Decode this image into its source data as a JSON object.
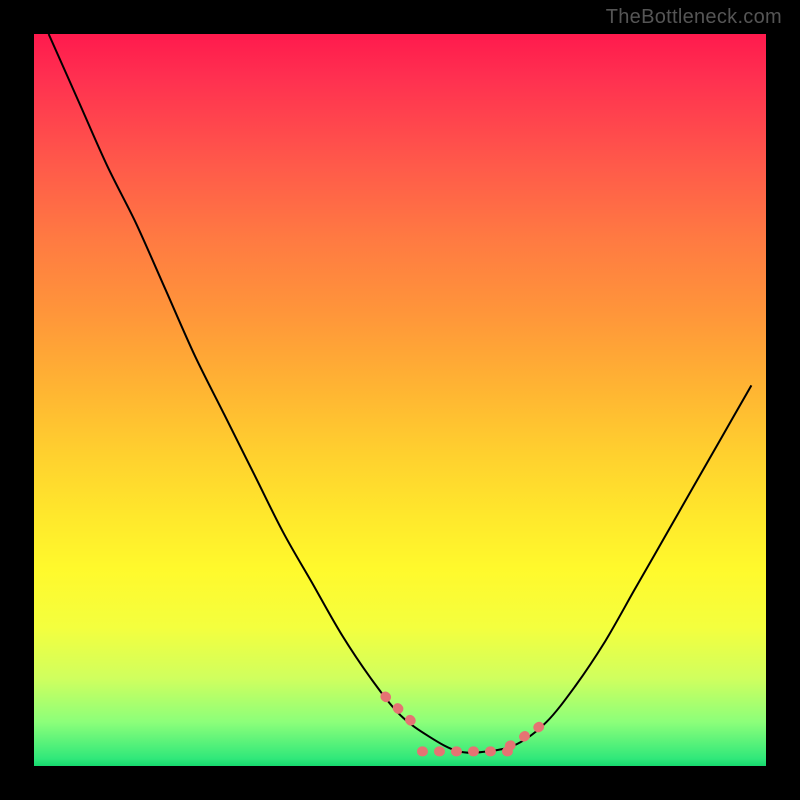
{
  "attribution": "TheBottleneck.com",
  "colors": {
    "gradient_top": "#ff1a4d",
    "gradient_mid": "#ffe82c",
    "gradient_bottom": "#16d86e",
    "curve": "#000000",
    "highlight": "#e57373",
    "border": "#000000"
  },
  "chart_data": {
    "type": "line",
    "title": "",
    "xlabel": "",
    "ylabel": "",
    "xlim": [
      0,
      1
    ],
    "ylim": [
      0,
      1
    ],
    "note": "Axes have no visible ticks or labels. Values below are normalized estimates read from the plotted curve (0 = left/bottom, 1 = right/top).",
    "x": [
      0.02,
      0.06,
      0.1,
      0.14,
      0.18,
      0.22,
      0.26,
      0.3,
      0.34,
      0.38,
      0.42,
      0.46,
      0.5,
      0.54,
      0.58,
      0.62,
      0.66,
      0.7,
      0.74,
      0.78,
      0.82,
      0.86,
      0.9,
      0.94,
      0.98
    ],
    "values": [
      1.0,
      0.91,
      0.82,
      0.74,
      0.65,
      0.56,
      0.48,
      0.4,
      0.32,
      0.25,
      0.18,
      0.12,
      0.07,
      0.04,
      0.02,
      0.02,
      0.03,
      0.06,
      0.11,
      0.17,
      0.24,
      0.31,
      0.38,
      0.45,
      0.52
    ],
    "highlight_region": {
      "x_start": 0.5,
      "x_end": 0.68
    },
    "annotations": []
  }
}
